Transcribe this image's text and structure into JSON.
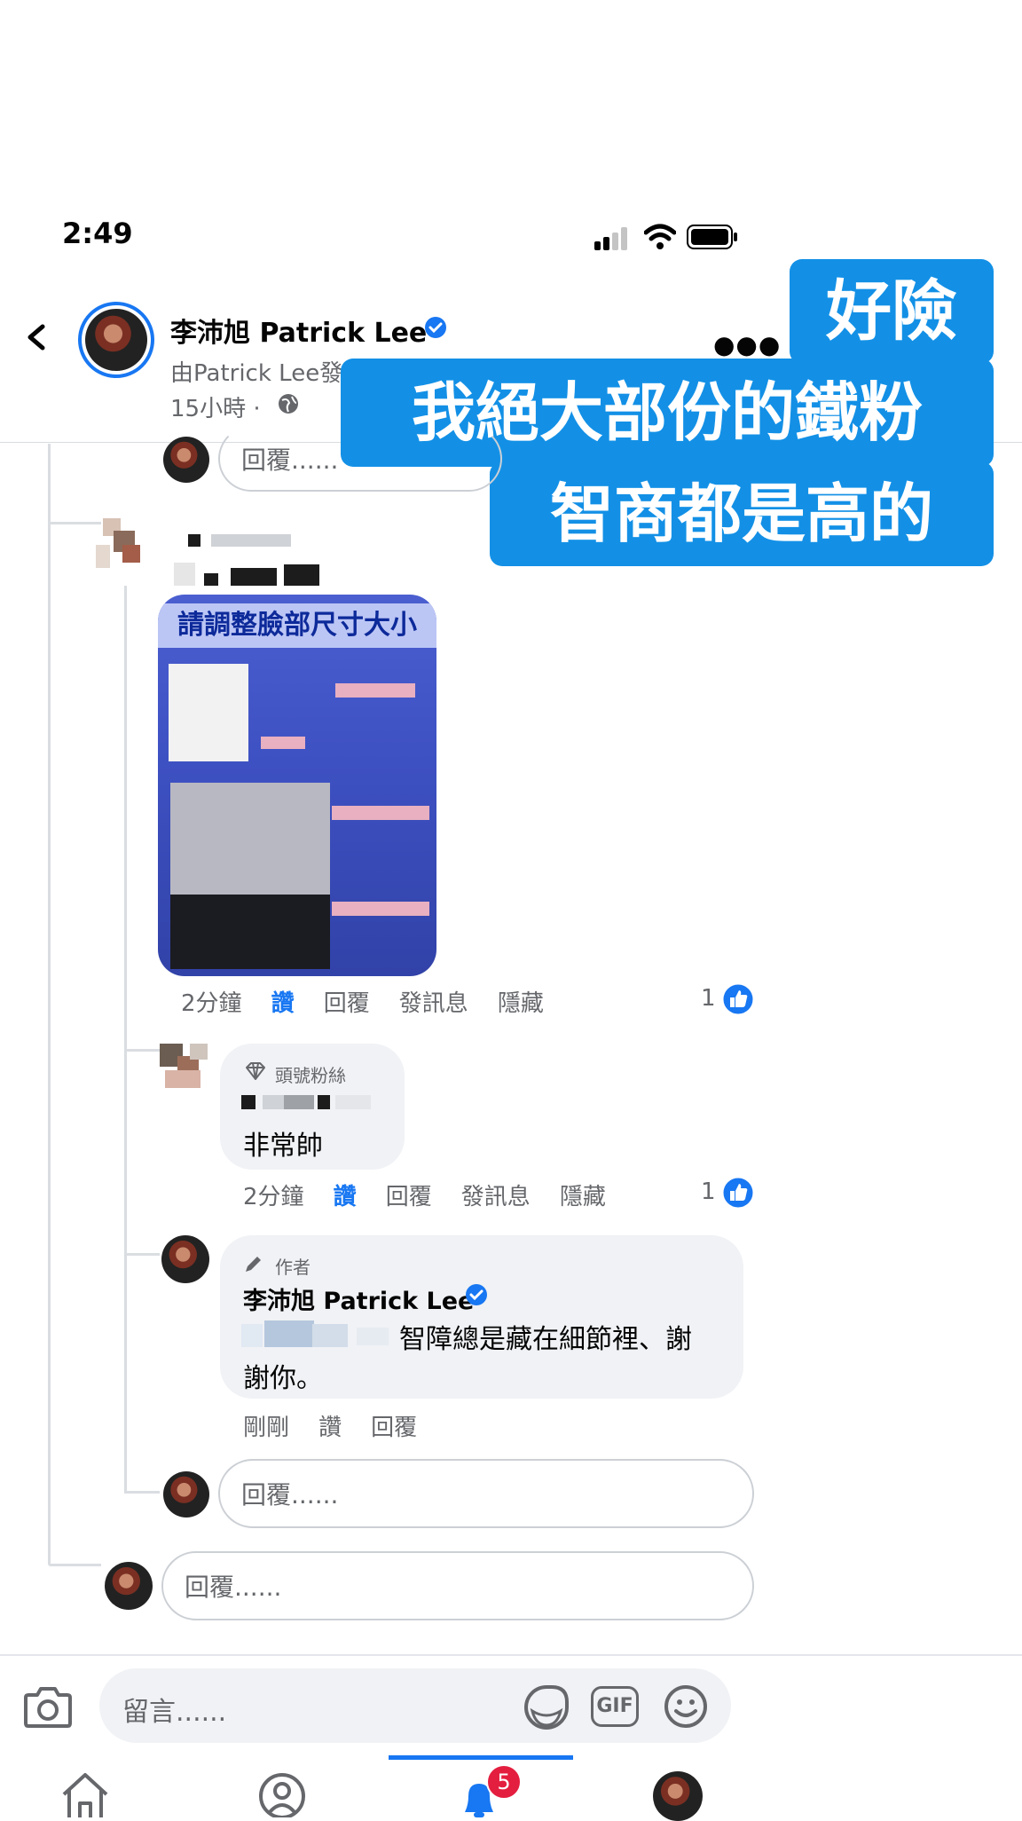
{
  "status_bar": {
    "time": "2:49"
  },
  "header": {
    "name": "李沛旭 Patrick Lee",
    "subtitle": "由Patrick Lee發",
    "time": "15小時 ·"
  },
  "caption": {
    "line1": "好險",
    "line2": "我絕大部份的鐵粉",
    "line3": "智商都是高的"
  },
  "reply_placeholder": "回覆......",
  "photo_comment": {
    "photo_title": "請調整臉部尺寸大小",
    "time": "2分鐘",
    "like": "讚",
    "reply": "回覆",
    "message": "發訊息",
    "hide": "隱藏",
    "like_count": "1"
  },
  "fan_comment": {
    "badge": "頭號粉絲",
    "text": "非常帥",
    "time": "2分鐘",
    "like": "讚",
    "reply": "回覆",
    "message": "發訊息",
    "hide": "隱藏",
    "like_count": "1"
  },
  "author_comment": {
    "badge": "作者",
    "name": "李沛旭 Patrick Lee",
    "text_line1": "智障總是藏在細節裡、謝",
    "text_line2": "謝你。",
    "time": "剛剛",
    "like": "讚",
    "reply": "回覆"
  },
  "composer": {
    "placeholder": "留言......",
    "gif_label": "GIF"
  },
  "nav": {
    "notification_count": "5"
  },
  "colors": {
    "accent": "#1877f2",
    "caption_bg": "#1390e6",
    "badge_red": "#e41e3f"
  }
}
